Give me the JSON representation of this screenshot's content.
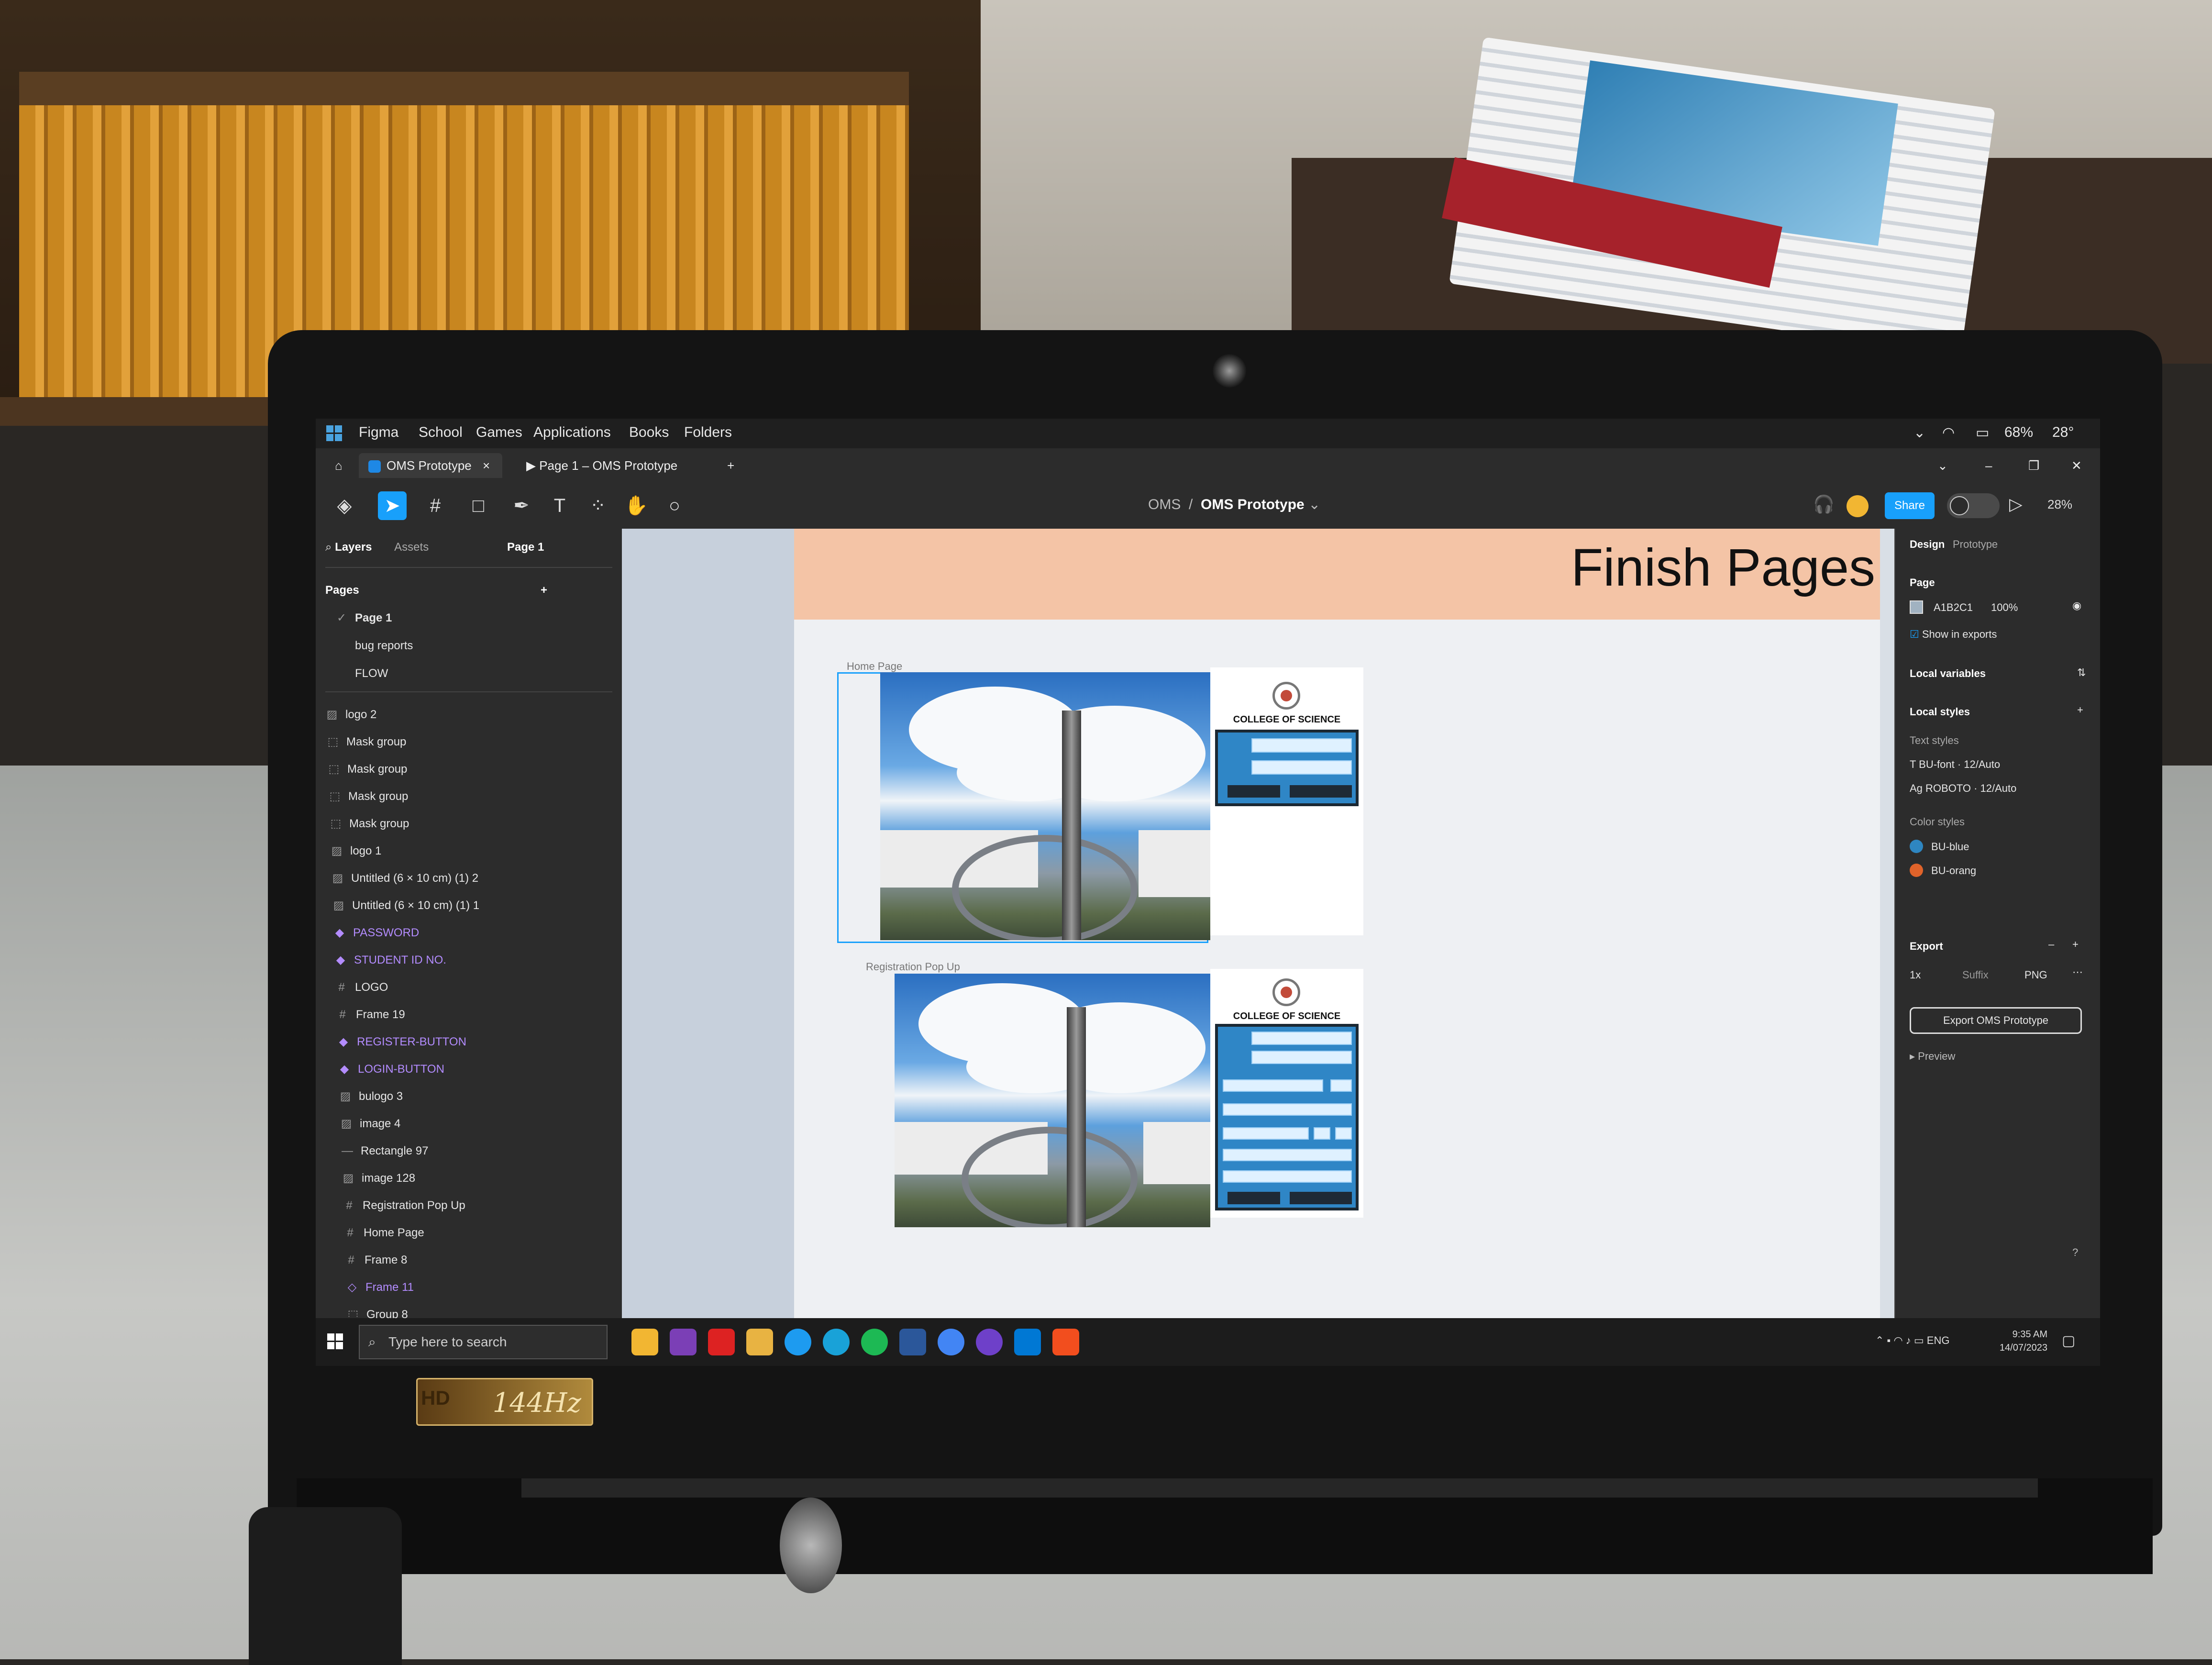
{
  "menubar": {
    "items": [
      "Figma",
      "School",
      "Games",
      "Applications",
      "Books",
      "Folders"
    ],
    "battery": "68%",
    "weather": "28°"
  },
  "tabs": [
    {
      "label": "OMS Prototype",
      "active": true
    },
    {
      "label": "Page 1 – OMS Prototype",
      "active": false
    }
  ],
  "toolbar": {
    "breadcrumb_project": "OMS",
    "breadcrumb_file": "OMS Prototype",
    "share_label": "Share",
    "zoom": "28%"
  },
  "left_panel": {
    "tab_layers": "Layers",
    "tab_assets": "Assets",
    "page_selector": "Page 1",
    "pages_header": "Pages",
    "pages": [
      "Page 1",
      "bug reports",
      "FLOW"
    ],
    "layers": [
      {
        "label": "logo 2",
        "kind": "image"
      },
      {
        "label": "Mask group",
        "kind": "mask"
      },
      {
        "label": "Mask group",
        "kind": "mask"
      },
      {
        "label": "Mask group",
        "kind": "mask"
      },
      {
        "label": "Mask group",
        "kind": "mask"
      },
      {
        "label": "logo 1",
        "kind": "image"
      },
      {
        "label": "Untitled (6 × 10 cm) (1) 2",
        "kind": "image"
      },
      {
        "label": "Untitled (6 × 10 cm) (1) 1",
        "kind": "image"
      },
      {
        "label": "PASSWORD",
        "kind": "component"
      },
      {
        "label": "STUDENT ID NO.",
        "kind": "component"
      },
      {
        "label": "LOGO",
        "kind": "frame"
      },
      {
        "label": "Frame 19",
        "kind": "frame"
      },
      {
        "label": "REGISTER-BUTTON",
        "kind": "component"
      },
      {
        "label": "LOGIN-BUTTON",
        "kind": "component"
      },
      {
        "label": "bulogo 3",
        "kind": "image"
      },
      {
        "label": "image 4",
        "kind": "image"
      },
      {
        "label": "Rectangle 97",
        "kind": "rect"
      },
      {
        "label": "image 128",
        "kind": "image"
      },
      {
        "label": "Registration Pop Up",
        "kind": "frame"
      },
      {
        "label": "Home Page",
        "kind": "frame"
      },
      {
        "label": "Frame 8",
        "kind": "frame"
      },
      {
        "label": "Frame 11",
        "kind": "component-outline"
      },
      {
        "label": "Group 8",
        "kind": "group"
      }
    ]
  },
  "canvas": {
    "banner_title": "Finish Pages",
    "frame_home_label": "Home Page",
    "frame_registration_label": "Registration Pop Up",
    "college_title": "COLLEGE OF SCIENCE",
    "banner_color": "#F4C4A6"
  },
  "right_panel": {
    "tab_design": "Design",
    "tab_prototype": "Prototype",
    "page_header": "Page",
    "page_color_hex": "A1B2C1",
    "page_opacity": "100%",
    "show_in_exports": "Show in exports",
    "local_variables": "Local variables",
    "local_styles": "Local styles",
    "text_styles_header": "Text styles",
    "text_styles": [
      "BU-font · 12/Auto",
      "ROBOTO · 12/Auto"
    ],
    "color_styles_header": "Color styles",
    "color_styles": [
      {
        "name": "BU-blue",
        "color": "#2E86C1"
      },
      {
        "name": "BU-orang",
        "color": "#E0632A"
      }
    ],
    "export_header": "Export",
    "export_scale": "1x",
    "export_suffix": "Suffix",
    "export_format": "PNG",
    "export_button": "Export OMS Prototype",
    "preview": "Preview",
    "help": "?"
  },
  "taskbar": {
    "search_placeholder": "Type here to search",
    "language": "ENG",
    "time": "9:35 AM",
    "date": "14/07/2023"
  },
  "sticker": {
    "badge": "HD",
    "refresh": "144Hz"
  }
}
